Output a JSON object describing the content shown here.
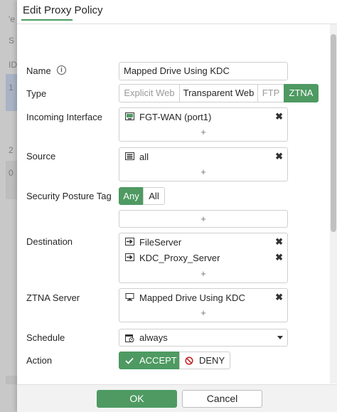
{
  "background": {
    "fragments": [
      "'e",
      "S",
      "ID",
      "1",
      "2",
      "0"
    ]
  },
  "dialog": {
    "title": "Edit Proxy Policy"
  },
  "form": {
    "name": {
      "label": "Name",
      "value": "Mapped Drive Using KDC"
    },
    "type": {
      "label": "Type",
      "options": [
        "Explicit Web",
        "Transparent Web",
        "FTP",
        "ZTNA"
      ],
      "selected": "ZTNA"
    },
    "incoming_interface": {
      "label": "Incoming Interface",
      "items": [
        "FGT-WAN (port1)"
      ],
      "add": "+"
    },
    "source": {
      "label": "Source",
      "items": [
        "all"
      ],
      "add": "+"
    },
    "security_posture_tag": {
      "label": "Security Posture Tag",
      "options": [
        "Any",
        "All"
      ],
      "selected": "Any",
      "add": "+"
    },
    "destination": {
      "label": "Destination",
      "items": [
        "FileServer",
        "KDC_Proxy_Server"
      ],
      "add": "+"
    },
    "ztna_server": {
      "label": "ZTNA Server",
      "items": [
        "Mapped Drive Using KDC"
      ],
      "add": "+"
    },
    "schedule": {
      "label": "Schedule",
      "value": "always"
    },
    "action": {
      "label": "Action",
      "options": [
        "ACCEPT",
        "DENY"
      ],
      "selected": "ACCEPT"
    }
  },
  "footer": {
    "ok": "OK",
    "cancel": "Cancel"
  },
  "colors": {
    "accent": "#4e9a62",
    "border": "#cfcfcf",
    "deny": "#c62828"
  },
  "remove_glyph": "✖"
}
